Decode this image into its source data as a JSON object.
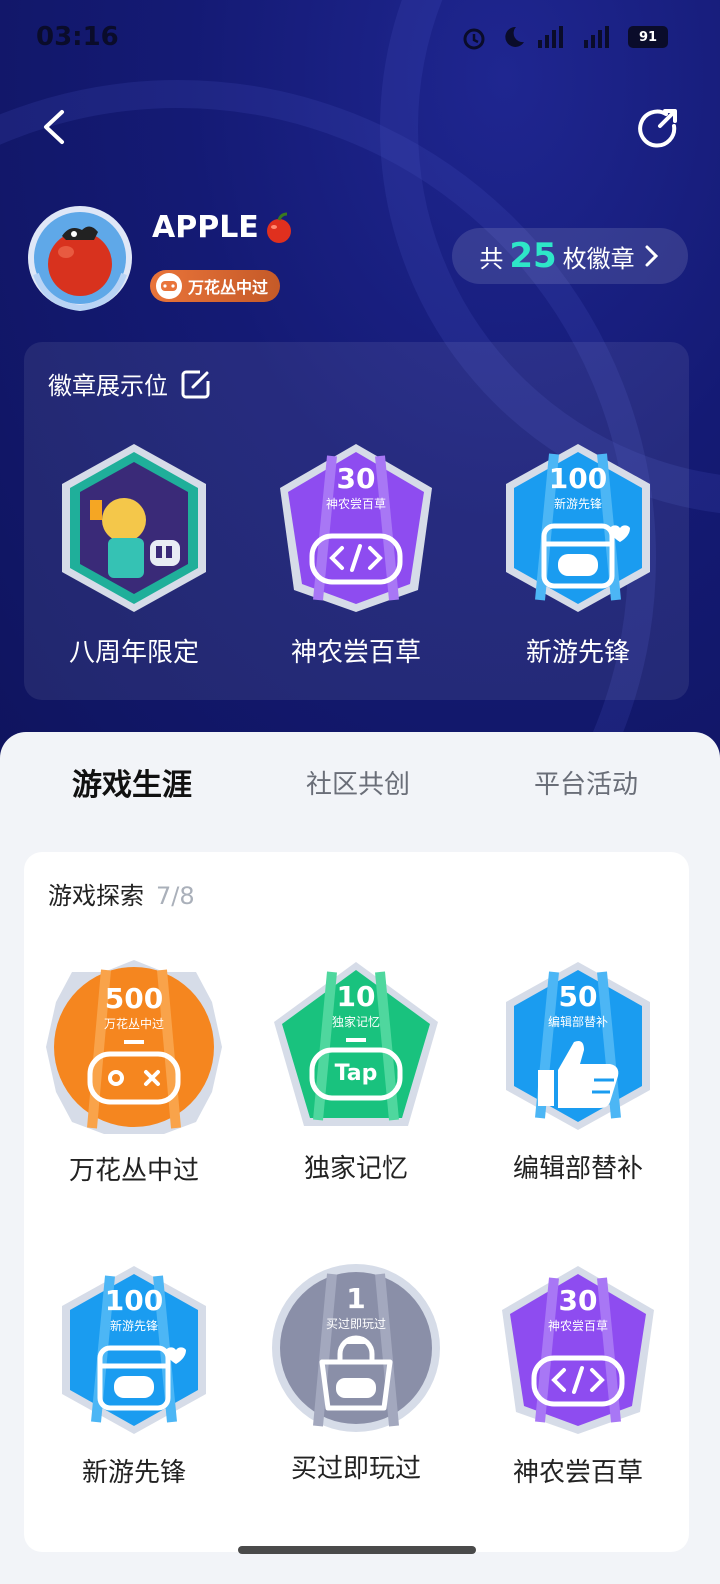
{
  "status_bar": {
    "time": "03:16",
    "battery": "91"
  },
  "profile": {
    "username": "APPLE",
    "title_badge": "万花丛中过"
  },
  "total_badges": {
    "prefix": "共",
    "count": "25",
    "suffix": "枚徽章"
  },
  "showcase": {
    "title": "徽章展示位",
    "items": [
      {
        "label": "八周年限定",
        "number": "",
        "caption": ""
      },
      {
        "label": "神农尝百草",
        "number": "30",
        "caption": "神农尝百草"
      },
      {
        "label": "新游先锋",
        "number": "100",
        "caption": "新游先锋"
      }
    ]
  },
  "tabs": [
    {
      "label": "游戏生涯",
      "active": true
    },
    {
      "label": "社区共创",
      "active": false
    },
    {
      "label": "平台活动",
      "active": false
    }
  ],
  "section": {
    "title": "游戏探索",
    "progress": "7/8",
    "badges": [
      {
        "label": "万花丛中过",
        "number": "500",
        "caption": "万花丛中过",
        "color": "#f5861f"
      },
      {
        "label": "独家记忆",
        "number": "10",
        "caption": "独家记忆",
        "color": "#19c27e"
      },
      {
        "label": "编辑部替补",
        "number": "50",
        "caption": "编辑部替补",
        "color": "#1a9cf0"
      },
      {
        "label": "新游先锋",
        "number": "100",
        "caption": "新游先锋",
        "color": "#1a9cf0"
      },
      {
        "label": "买过即玩过",
        "number": "1",
        "caption": "买过即玩过",
        "color": "#8a8fa8"
      },
      {
        "label": "神农尝百草",
        "number": "30",
        "caption": "神农尝百草",
        "color": "#8e4cf0"
      }
    ],
    "inner_texts": {
      "tap": "Tap"
    }
  },
  "colors": {
    "accent": "#2ee6c8",
    "hero_bg": "#141a74",
    "title_badge": "#d8653a"
  }
}
